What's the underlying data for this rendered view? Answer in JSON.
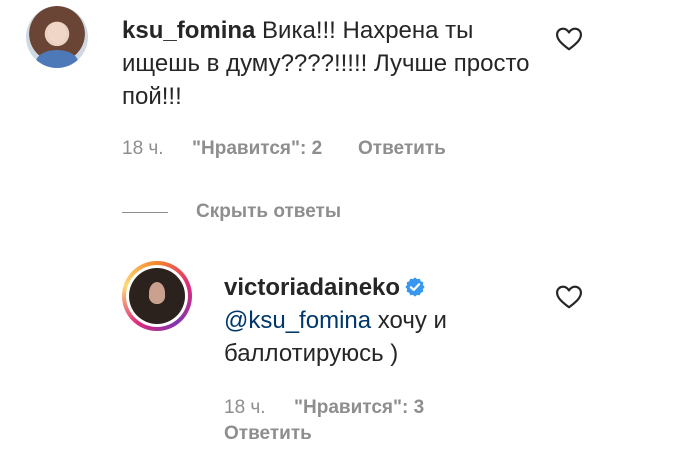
{
  "comment": {
    "username": "ksu_fomina",
    "text": "Вика!!! Нахрена ты ищешь в думу????!!!!! Лучше просто пой!!!",
    "time": "18 ч.",
    "likes": "\"Нравится\": 2",
    "reply_label": "Ответить"
  },
  "hide_replies_label": "Скрыть ответы",
  "reply": {
    "username": "victoriadaineko",
    "mention": "@ksu_fomina",
    "text": " хочу и баллотируюсь )",
    "time": "18 ч.",
    "likes": "\"Нравится\": 3",
    "reply_label": "Ответить"
  },
  "colors": {
    "text": "#262626",
    "secondary": "#8e8e8e",
    "mention": "#00376b",
    "verified": "#3897f0"
  },
  "icons": {
    "like": "heart-outline-icon",
    "verified": "verified-badge-icon"
  }
}
